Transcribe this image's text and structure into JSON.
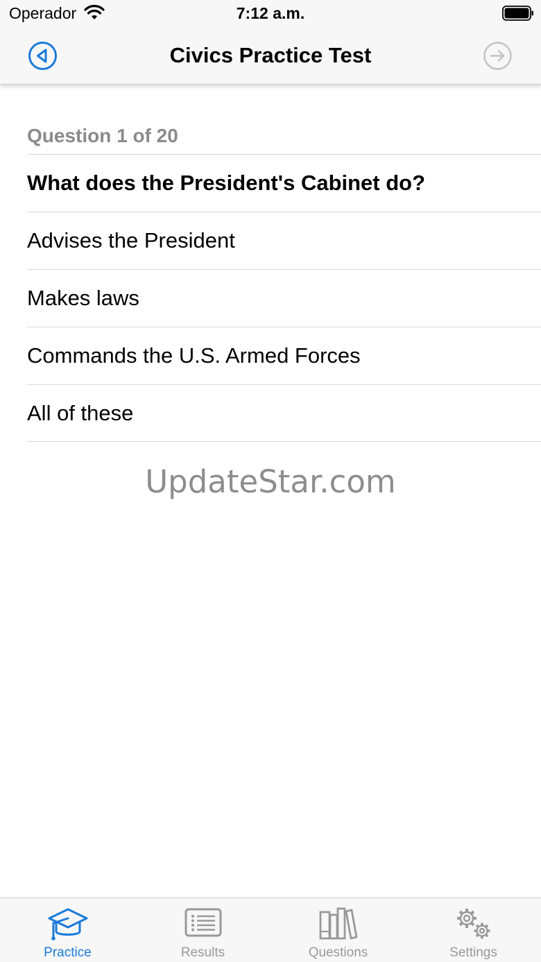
{
  "status_bar": {
    "carrier": "Operador",
    "time": "7:12 a.m."
  },
  "nav": {
    "title": "Civics Practice Test",
    "back_icon": "circle-back-arrow-icon",
    "next_icon": "circle-forward-arrow-icon"
  },
  "quiz": {
    "counter": "Question 1 of 20",
    "question": "What does the President's Cabinet do?",
    "answers": [
      "Advises the President",
      "Makes laws",
      "Commands the U.S. Armed Forces",
      "All of these"
    ]
  },
  "watermark": "UpdateStar.com",
  "tabs": [
    {
      "label": "Practice",
      "icon": "graduation-cap-icon",
      "active": true
    },
    {
      "label": "Results",
      "icon": "list-icon",
      "active": false
    },
    {
      "label": "Questions",
      "icon": "books-icon",
      "active": false
    },
    {
      "label": "Settings",
      "icon": "gears-icon",
      "active": false
    }
  ],
  "colors": {
    "accent": "#1a7ad9",
    "inactive": "#999999",
    "bar_background": "#f7f7f7"
  }
}
